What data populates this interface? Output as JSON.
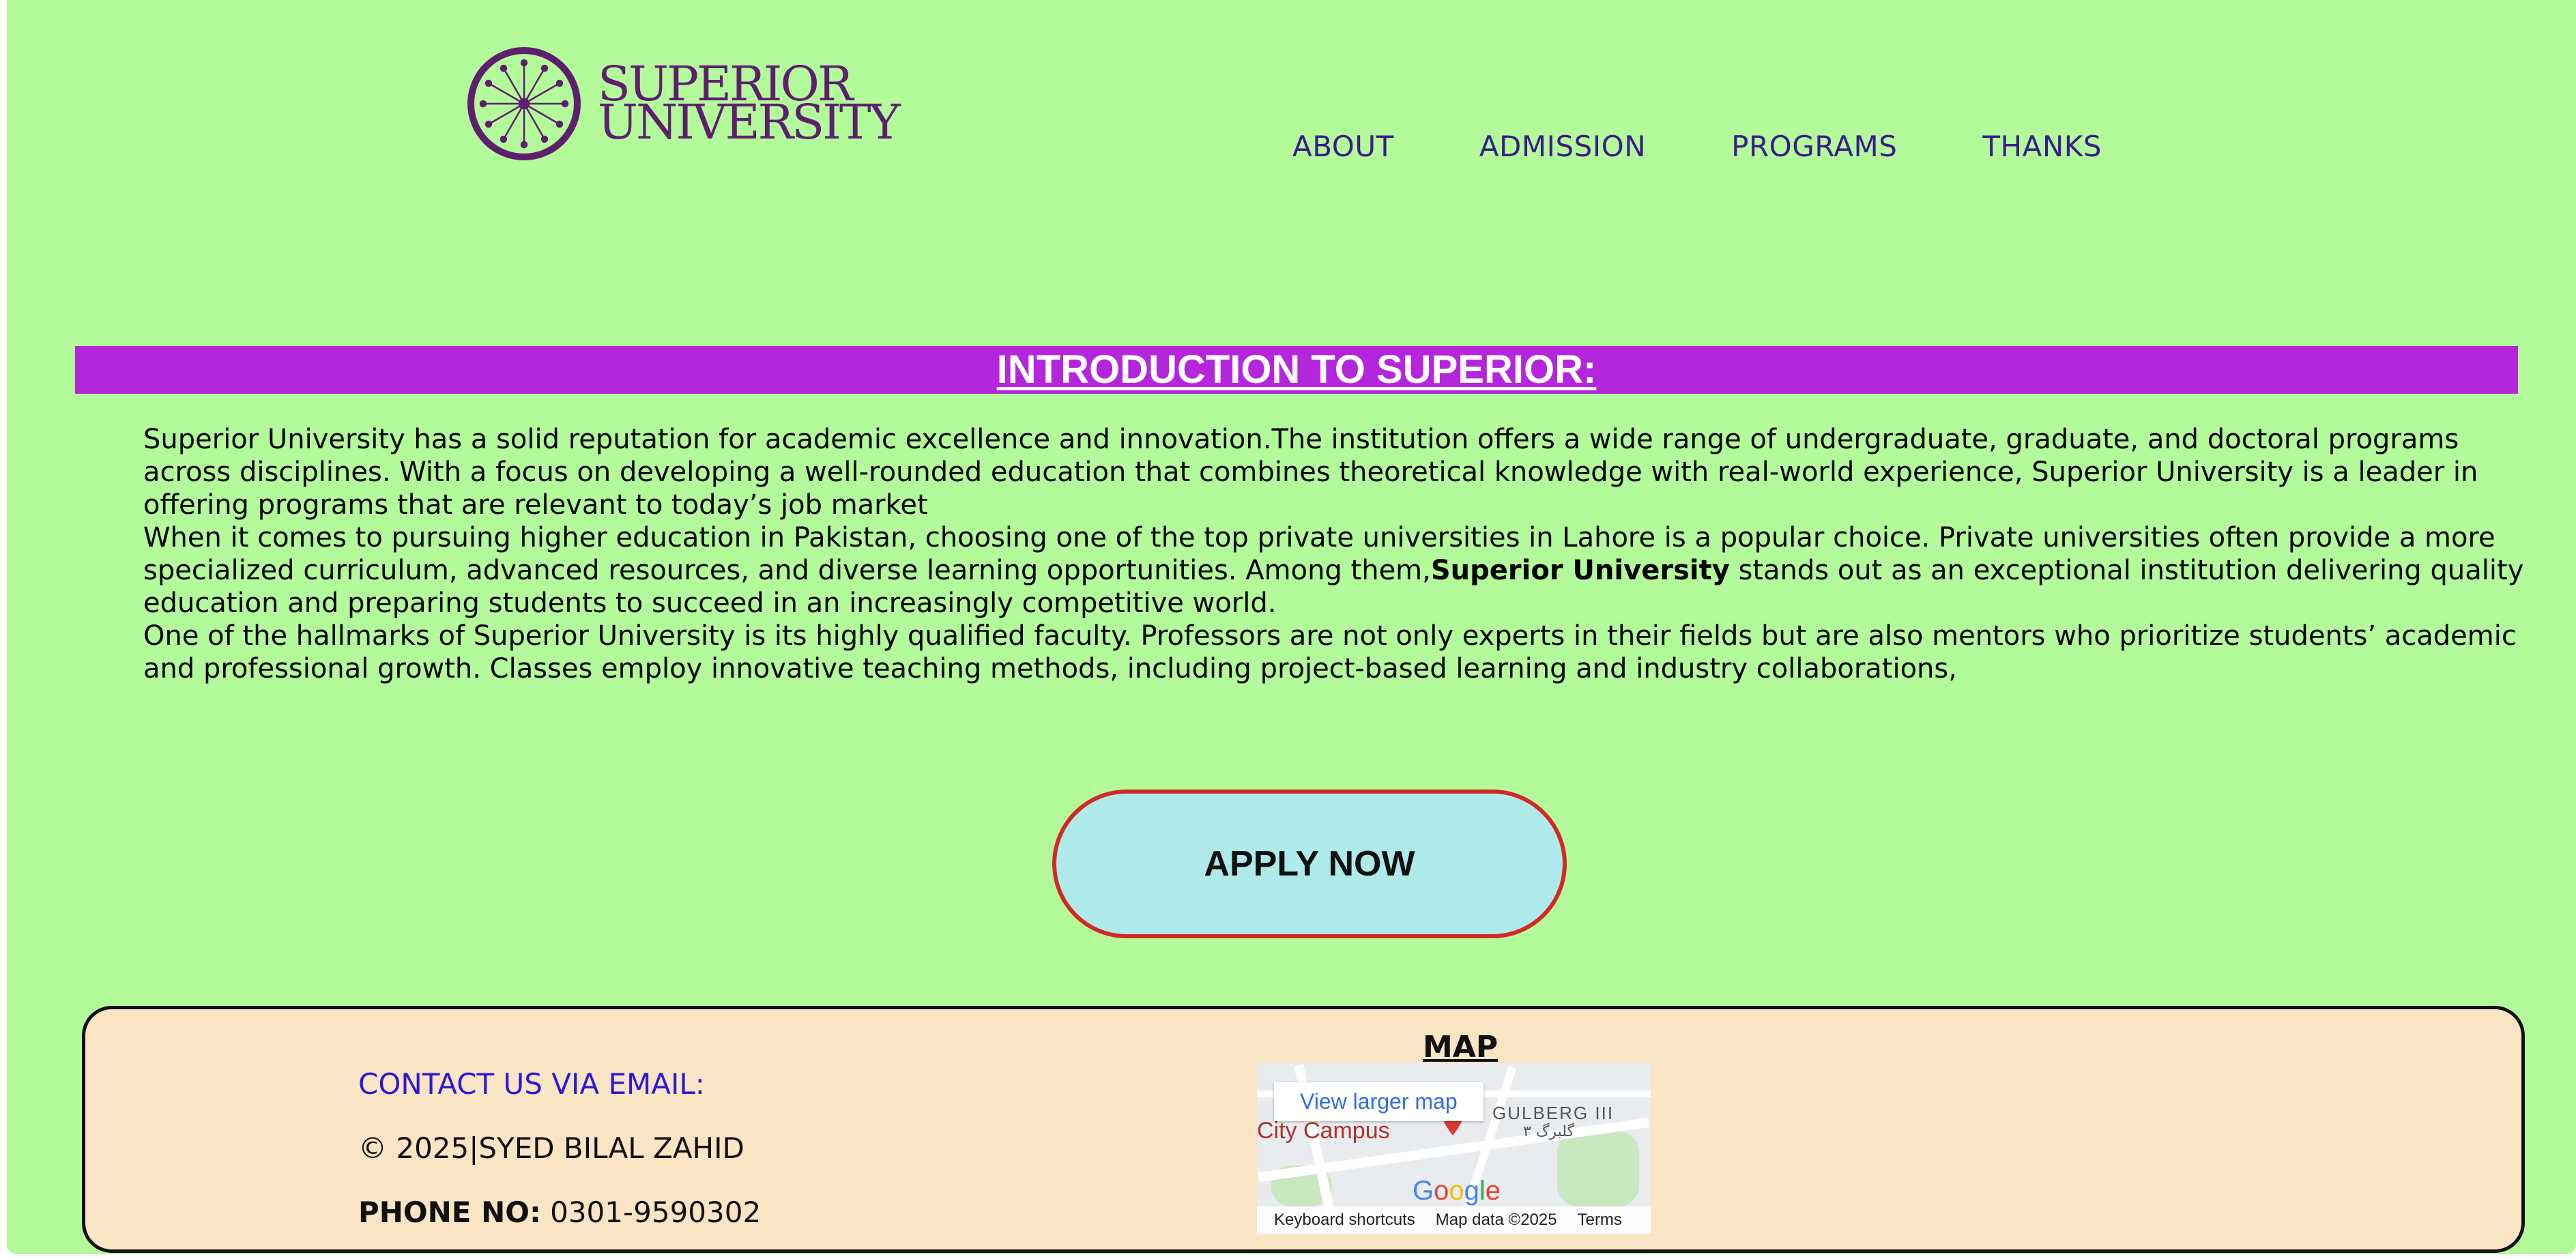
{
  "header": {
    "logo_line1": "SUPERIOR",
    "logo_line2": "UNIVERSITY",
    "nav": [
      {
        "label": "ABOUT"
      },
      {
        "label": "ADMISSION"
      },
      {
        "label": "PROGRAMS"
      },
      {
        "label": "THANKS"
      }
    ]
  },
  "intro": {
    "title": "INTRODUCTION TO SUPERIOR:",
    "p1": "Superior University has a solid reputation for academic excellence and innovation.The institution offers a wide range of undergraduate, graduate, and doctoral programs across disciplines. With a focus on developing a well-rounded education that combines theoretical knowledge with real-world experience, Superior University is a leader in offering programs that are relevant to today’s job market",
    "p2_before": "When it comes to pursuing higher education in Pakistan, choosing one of the top private universities in Lahore is a popular choice. Private universities often provide a more specialized curriculum, advanced resources, and diverse learning opportunities. Among them,",
    "p2_bold": "Superior University",
    "p2_after": " stands out as an exceptional institution delivering quality education and preparing students to succeed in an increasingly competitive world.",
    "p3": "One of the hallmarks of Superior University is its highly qualified faculty. Professors are not only experts in their fields but are also mentors who prioritize students’ academic and professional growth. Classes employ innovative teaching methods, including project-based learning and industry collaborations,"
  },
  "apply_label": "APPLY NOW",
  "footer": {
    "email_label": "CONTACT US VIA EMAIL:",
    "copyright": "© 2025|SYED BILAL ZAHID",
    "phone_label": "PHONE NO:",
    "phone_value": " 0301-9590302",
    "map_title": "MAP",
    "map": {
      "larger_map": "View larger map",
      "place": "City Campus",
      "area": "GULBERG III",
      "area_urdu": "گلبرگ ۳",
      "brand_letters": [
        "G",
        "o",
        "o",
        "g",
        "l",
        "e"
      ],
      "attribution": [
        "Keyboard shortcuts",
        "Map data ©2025",
        "Terms"
      ]
    }
  },
  "colors": {
    "page_bg": "#b3fa9b",
    "banner": "#b426dc",
    "nav_text": "#3a1c8a",
    "apply_bg": "#afeaeb",
    "apply_border": "#d42828",
    "footer_bg": "#f9e4c4",
    "email_text": "#2a1ad6"
  }
}
